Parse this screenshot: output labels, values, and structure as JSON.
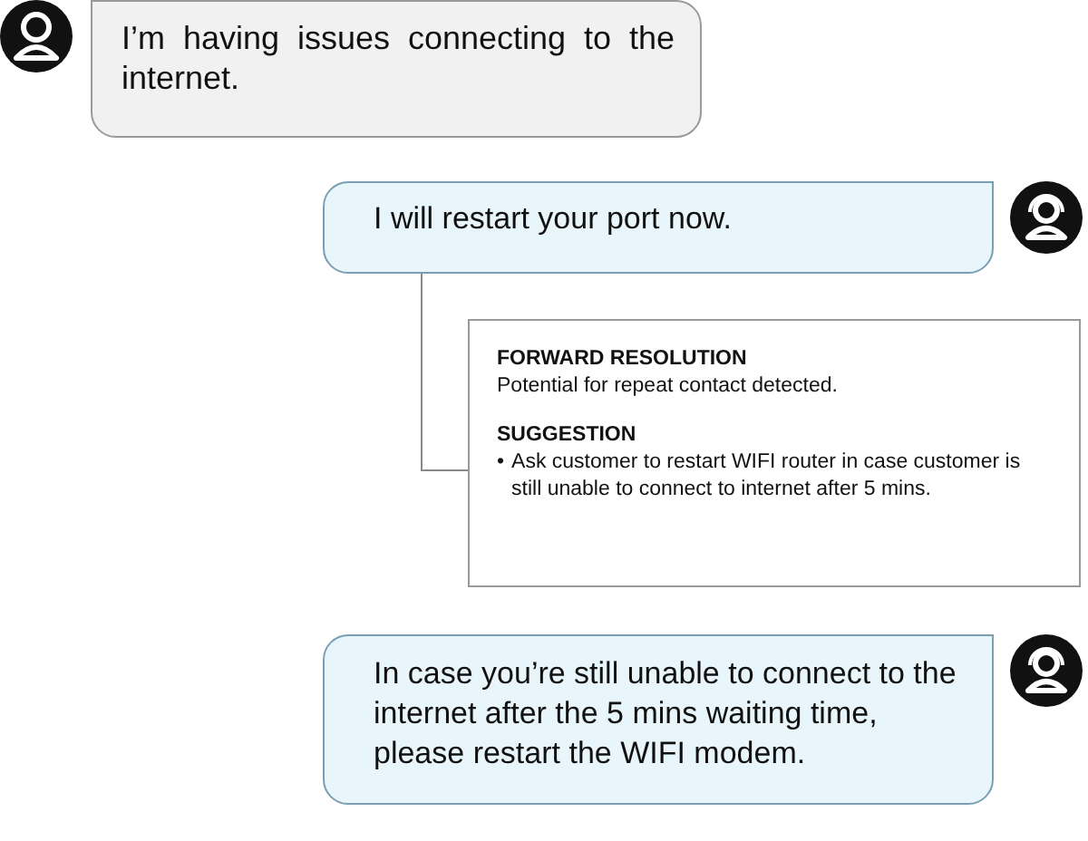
{
  "messages": [
    {
      "kind": "customer",
      "text": "I’m having issues connecting to the internet."
    },
    {
      "kind": "agent",
      "text": "I will restart your port now.",
      "note": {
        "sections": [
          {
            "kind": "text",
            "heading": "FORWARD RESOLUTION",
            "text": "Potential for repeat contact detected."
          },
          {
            "kind": "bullets",
            "heading": "SUGGESTION",
            "marker": "•",
            "items": [
              "Ask customer to restart WIFI router in case customer is still unable to connect to internet after 5 mins."
            ]
          }
        ]
      }
    },
    {
      "kind": "agent",
      "text": "In case you’re still unable to connect to the internet after the 5 mins waiting time, please restart the WIFI modem."
    }
  ]
}
